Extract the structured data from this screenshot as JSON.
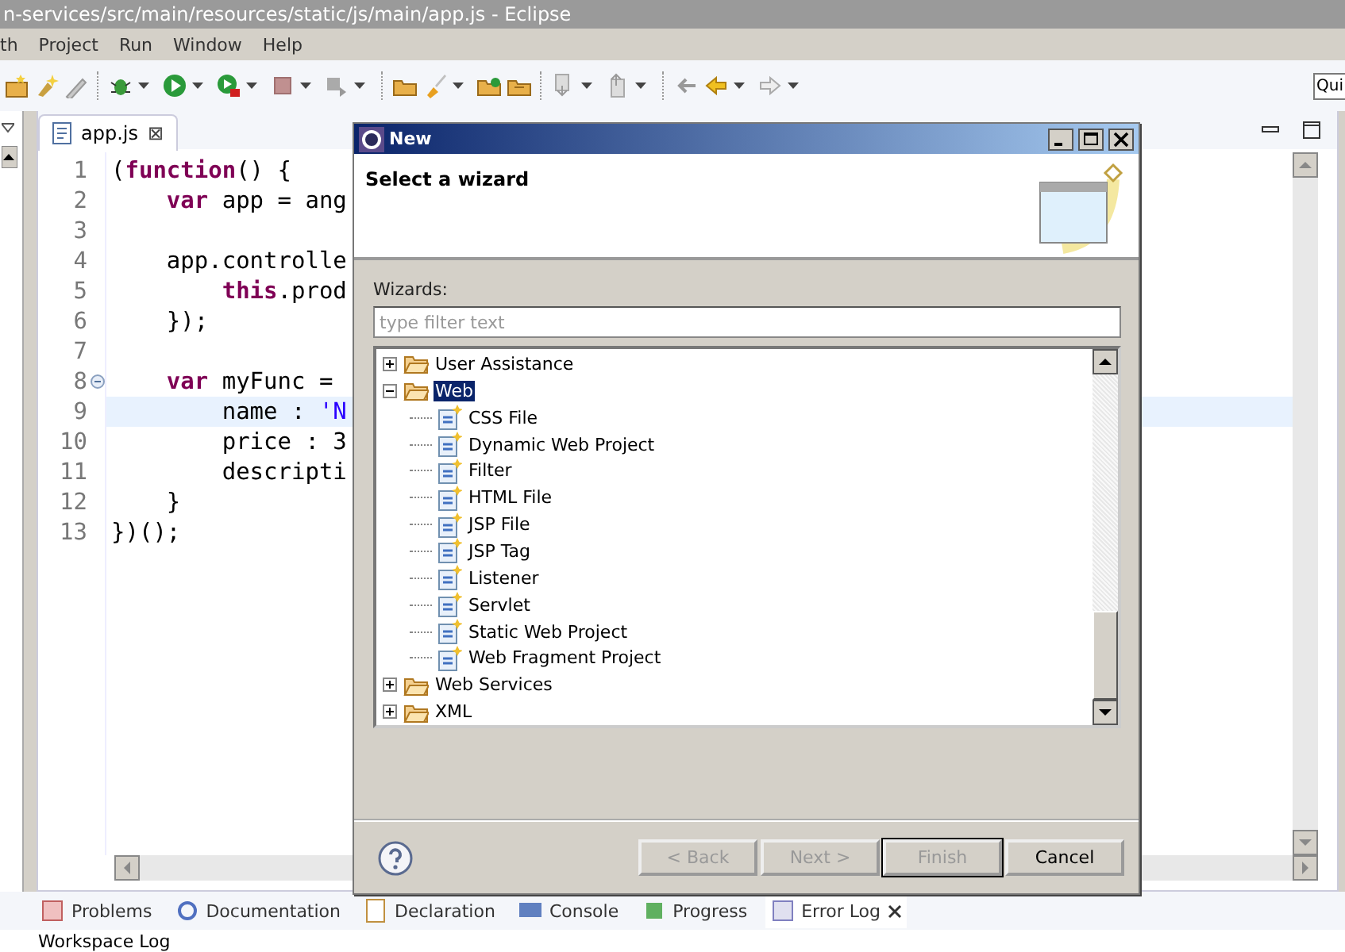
{
  "window": {
    "title": "n-services/src/main/resources/static/js/main/app.js - Eclipse"
  },
  "menu": [
    "th",
    "Project",
    "Run",
    "Window",
    "Help"
  ],
  "quick_access": {
    "value": "Qui"
  },
  "editor": {
    "tab": {
      "label": "app.js",
      "close": "⊠"
    },
    "lines": [
      {
        "number": "1",
        "current": false,
        "fold_marker": false,
        "segments": [
          {
            "kind": "plain",
            "text": "("
          },
          {
            "kind": "keyword",
            "text": "function"
          },
          {
            "kind": "plain",
            "text": "() {"
          }
        ]
      },
      {
        "number": "2",
        "current": false,
        "fold_marker": false,
        "segments": [
          {
            "kind": "keyword",
            "text": "    var"
          },
          {
            "kind": "plain",
            "text": " app = ang"
          }
        ]
      },
      {
        "number": "3",
        "current": false,
        "fold_marker": false
      },
      {
        "number": "4",
        "current": false,
        "fold_marker": false,
        "segments": [
          {
            "kind": "plain",
            "text": "    app.controlle"
          }
        ]
      },
      {
        "number": "5",
        "current": false,
        "fold_marker": false,
        "segments": [
          {
            "kind": "keyword",
            "text": "        this"
          },
          {
            "kind": "plain",
            "text": ".prod"
          }
        ]
      },
      {
        "number": "6",
        "current": false,
        "fold_marker": false,
        "segments": [
          {
            "kind": "plain",
            "text": "    });"
          }
        ]
      },
      {
        "number": "7",
        "current": false,
        "fold_marker": false
      },
      {
        "number": "8",
        "current": false,
        "fold_marker": true,
        "segments": [
          {
            "kind": "keyword",
            "text": "    var"
          },
          {
            "kind": "plain",
            "text": " myFunc ="
          }
        ]
      },
      {
        "number": "9",
        "current": true,
        "fold_marker": false,
        "segments": [
          {
            "kind": "plain",
            "text": "        name : "
          },
          {
            "kind": "string",
            "text": "'N"
          }
        ]
      },
      {
        "number": "10",
        "current": false,
        "fold_marker": false,
        "segments": [
          {
            "kind": "plain",
            "text": "        price : 3"
          }
        ]
      },
      {
        "number": "11",
        "current": false,
        "fold_marker": false,
        "segments": [
          {
            "kind": "plain",
            "text": "        descripti"
          }
        ]
      },
      {
        "number": "12",
        "current": false,
        "fold_marker": false,
        "segments": [
          {
            "kind": "plain",
            "text": "    }"
          }
        ]
      },
      {
        "number": "13",
        "current": false,
        "fold_marker": false,
        "segments": [
          {
            "kind": "plain",
            "text": "})();"
          }
        ]
      }
    ]
  },
  "dialog": {
    "title": "New",
    "heading": "Select a wizard",
    "wizards_label": "Wizards:",
    "filter": {
      "placeholder": "type filter text"
    },
    "tree": [
      {
        "label": "User Assistance",
        "expanded": false,
        "selected": false
      },
      {
        "label": "Web",
        "expanded": true,
        "selected": true,
        "children": [
          {
            "label": "CSS File",
            "selected": false
          },
          {
            "label": "Dynamic Web Project",
            "selected": false
          },
          {
            "label": "Filter",
            "selected": false
          },
          {
            "label": "HTML File",
            "selected": false
          },
          {
            "label": "JSP File",
            "selected": false
          },
          {
            "label": "JSP Tag",
            "selected": false
          },
          {
            "label": "Listener",
            "selected": false
          },
          {
            "label": "Servlet",
            "selected": false
          },
          {
            "label": "Static Web Project",
            "selected": false
          },
          {
            "label": "Web Fragment Project",
            "selected": false
          }
        ]
      },
      {
        "label": "Web Services",
        "expanded": false,
        "selected": false
      },
      {
        "label": "XML",
        "expanded": false,
        "selected": false
      }
    ],
    "buttons": [
      {
        "label": "< Back",
        "disabled": true,
        "default": false
      },
      {
        "label": "Next >",
        "disabled": true,
        "default": false
      },
      {
        "label": "Finish",
        "disabled": true,
        "default": true
      },
      {
        "label": "Cancel",
        "disabled": false,
        "default": false
      }
    ]
  },
  "bottom_tabs": [
    {
      "label": "Problems",
      "selected": false
    },
    {
      "label": "Documentation",
      "selected": false
    },
    {
      "label": "Declaration",
      "selected": false
    },
    {
      "label": "Console",
      "selected": false
    },
    {
      "label": "Progress",
      "selected": false
    },
    {
      "label": "Error Log",
      "selected": true
    }
  ],
  "bottom_panel": {
    "title": "Workspace Log"
  }
}
